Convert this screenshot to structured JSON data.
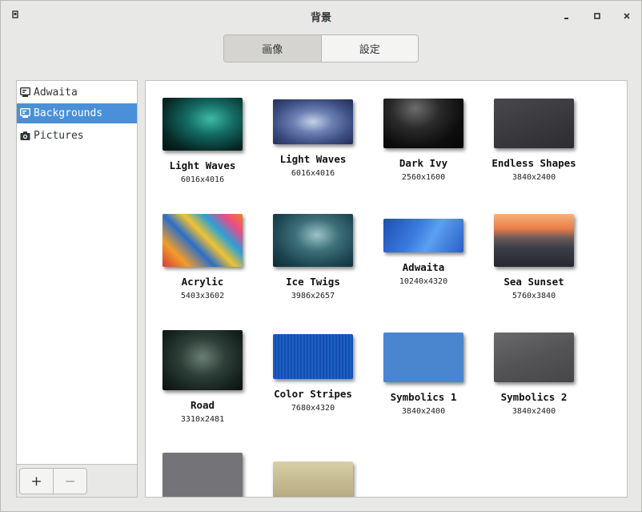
{
  "window": {
    "title": "背景"
  },
  "tabs": [
    {
      "label": "画像"
    },
    {
      "label": "設定"
    }
  ],
  "sidebar": {
    "items": [
      {
        "label": "Adwaita",
        "icon": "monitor-icon"
      },
      {
        "label": "Backgrounds",
        "icon": "monitor-icon"
      },
      {
        "label": "Pictures",
        "icon": "camera-icon"
      }
    ],
    "add_label": "+",
    "remove_label": "−"
  },
  "wallpapers": [
    {
      "name": "Light Waves",
      "resolution": "6016x4016"
    },
    {
      "name": "Light Waves",
      "resolution": "6016x4016"
    },
    {
      "name": "Dark Ivy",
      "resolution": "2560x1600"
    },
    {
      "name": "Endless Shapes",
      "resolution": "3840x2400"
    },
    {
      "name": "Acrylic",
      "resolution": "5403x3602"
    },
    {
      "name": "Ice Twigs",
      "resolution": "3986x2657"
    },
    {
      "name": "Adwaita",
      "resolution": "10240x4320"
    },
    {
      "name": "Sea Sunset",
      "resolution": "5760x3840"
    },
    {
      "name": "Road",
      "resolution": "3310x2481"
    },
    {
      "name": "Color Stripes",
      "resolution": "7680x4320"
    },
    {
      "name": "Symbolics 1",
      "resolution": "3840x2400"
    },
    {
      "name": "Symbolics 2",
      "resolution": "3840x2400"
    }
  ],
  "colors": {
    "selection": "#4a90d9",
    "accent_blue": "#4a86cf"
  }
}
